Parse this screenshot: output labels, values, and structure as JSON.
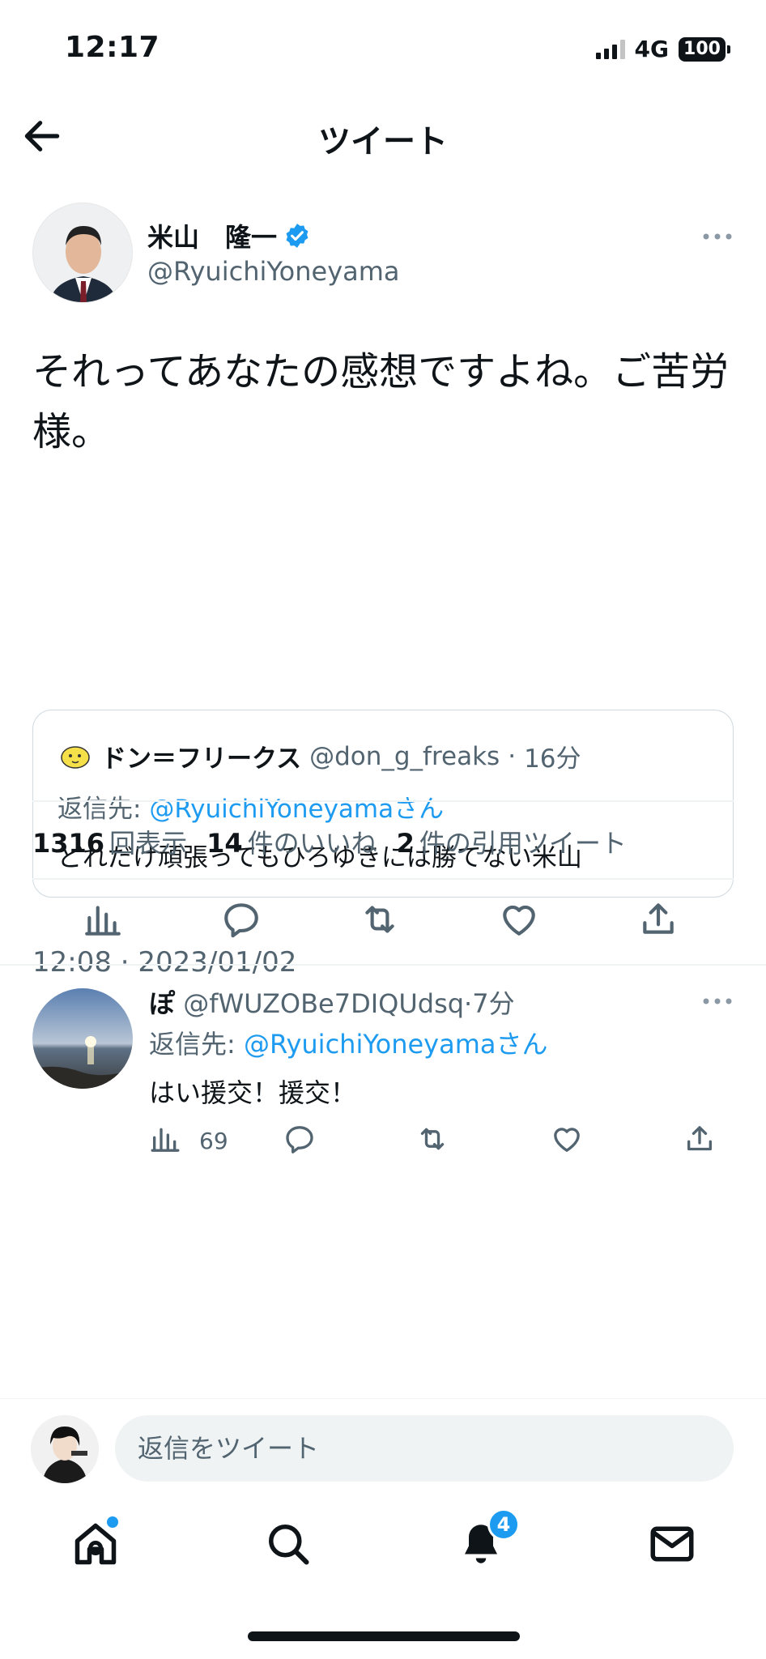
{
  "status_bar": {
    "time": "12:17",
    "network": "4G",
    "battery": "100"
  },
  "header": {
    "title": "ツイート"
  },
  "main_tweet": {
    "author_name": "米山　隆一",
    "author_handle": "@RyuichiYoneyama",
    "text": "それってあなたの感想ですよね。ご苦労様。",
    "quote": {
      "author_name": "ドン＝フリークス",
      "author_handle": "@don_g_freaks",
      "time_ago": "16分",
      "reply_prefix": "返信先: ",
      "reply_mention": "@RyuichiYoneyama",
      "reply_suffix": "さん",
      "text": "どれだけ頑張ってもひろゆきには勝てない米山"
    },
    "timestamp": "12:08 · 2023/01/02",
    "stats": {
      "views_count": "1316",
      "views_label": "回表示",
      "likes_count": "14",
      "likes_label": "件のいいね",
      "quotes_count": "2",
      "quotes_label": "件の引用ツイート"
    }
  },
  "reply_tweet": {
    "author_name": "ぽ",
    "author_handle": "@fWUZOBe7DIQUdsq",
    "time_ago": "7分",
    "reply_prefix": "返信先: ",
    "reply_mention": "@RyuichiYoneyama",
    "reply_suffix": "さん",
    "text": "はい援交！援交！",
    "view_count": "69"
  },
  "composer": {
    "placeholder": "返信をツイート"
  },
  "tab_bar": {
    "notifications_badge": "4"
  },
  "colors": {
    "accent": "#1d9bf0",
    "text": "#0f1419",
    "secondary": "#536471"
  }
}
